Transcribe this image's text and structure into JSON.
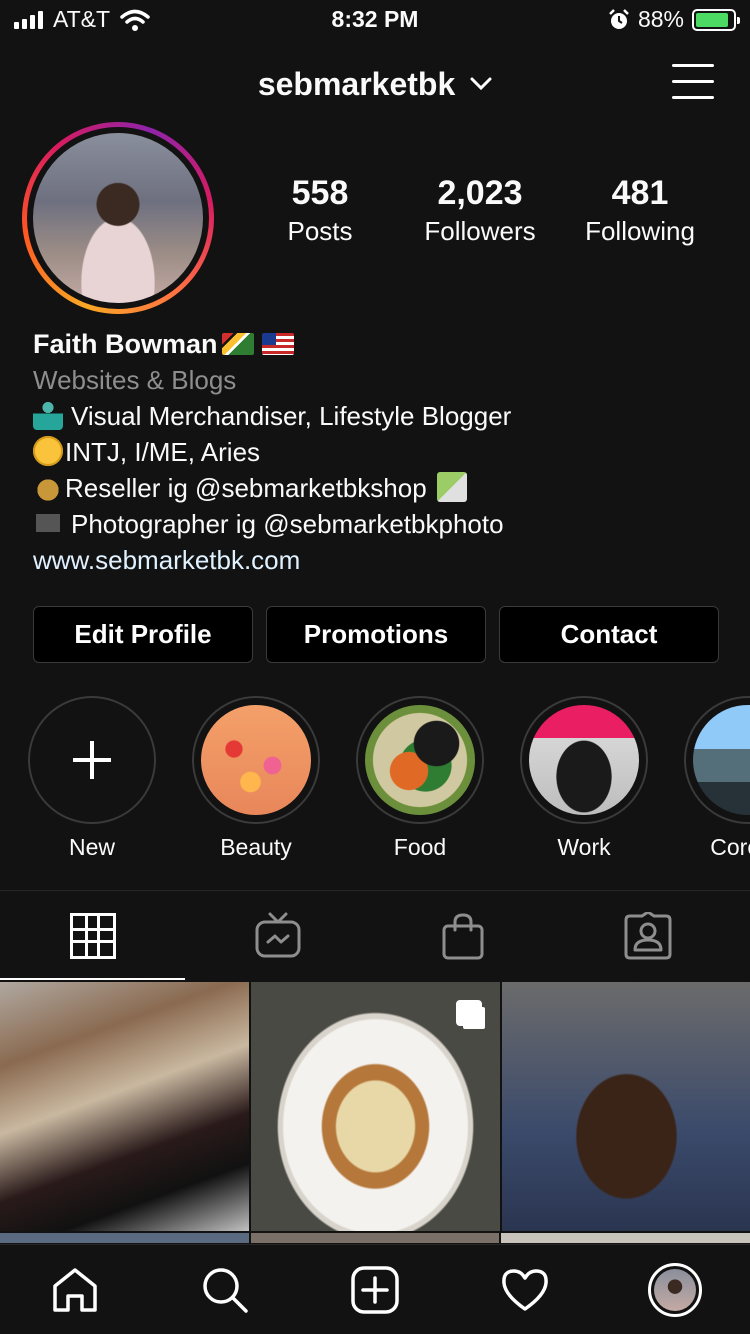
{
  "status_bar": {
    "carrier": "AT&T",
    "time": "8:32 PM",
    "battery_percent": "88%",
    "battery_level": 0.88,
    "icons": [
      "signal-icon",
      "wifi-icon",
      "alarm-icon",
      "battery-charging-icon"
    ]
  },
  "header": {
    "username": "sebmarketbk",
    "dropdown_icon": "chevron-down-icon",
    "menu_icon": "hamburger-menu-icon"
  },
  "profile": {
    "stats": [
      {
        "value": "558",
        "label": "Posts"
      },
      {
        "value": "2,023",
        "label": "Followers"
      },
      {
        "value": "481",
        "label": "Following"
      }
    ],
    "name": "Faith Bowman",
    "category": "Websites & Blogs",
    "bio_lines": [
      "Visual Merchandiser, Lifestyle Blogger",
      "INTJ, I/ME, Aries",
      "Reseller ig @sebmarketbkshop",
      "Photographer ig @sebmarketbkphoto"
    ],
    "website": "www.sebmarketbk.com"
  },
  "actions": {
    "edit_profile": "Edit Profile",
    "promotions": "Promotions",
    "contact": "Contact"
  },
  "highlights": [
    {
      "label": "New"
    },
    {
      "label": "Beauty"
    },
    {
      "label": "Food"
    },
    {
      "label": "Work"
    },
    {
      "label": "Corona"
    }
  ],
  "tabs": [
    "grid-icon",
    "igtv-icon",
    "shop-bag-icon",
    "tagged-icon"
  ],
  "colors": {
    "background": "#121212",
    "text": "#fafafa",
    "muted": "#8e8e8e",
    "link": "#e0f1ff",
    "border": "#3a3a3a"
  },
  "bottom_nav": [
    "home-icon",
    "search-icon",
    "add-post-icon",
    "activity-heart-icon",
    "profile-avatar"
  ]
}
